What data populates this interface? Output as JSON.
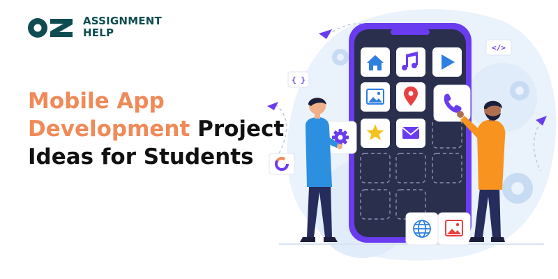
{
  "logo": {
    "mark": "OZ",
    "line1": "ASSIGNMENT",
    "line2": "HELP"
  },
  "headline": {
    "line1_highlight": "Mobile App",
    "line2_highlight": "Development",
    "line2_rest": " Project",
    "line3": "Ideas for Students"
  },
  "illustration": {
    "code_tags": [
      "</>",
      "{ }"
    ],
    "app_icons": [
      "home-icon",
      "music-icon",
      "play-icon",
      "image-icon",
      "location-pin-icon",
      "phone-icon",
      "gear-icon",
      "star-icon",
      "mail-icon",
      "globe-icon",
      "gallery-icon"
    ]
  },
  "colors": {
    "brand_teal": "#0e4c52",
    "accent_orange": "#f08a58",
    "phone_purple": "#6a3cf0",
    "icon_blue": "#2d7fe0",
    "icon_purple": "#6a3cf0",
    "icon_red": "#e84040",
    "icon_yellow": "#f8c21c",
    "bg_blob": "#eaf2fc"
  }
}
